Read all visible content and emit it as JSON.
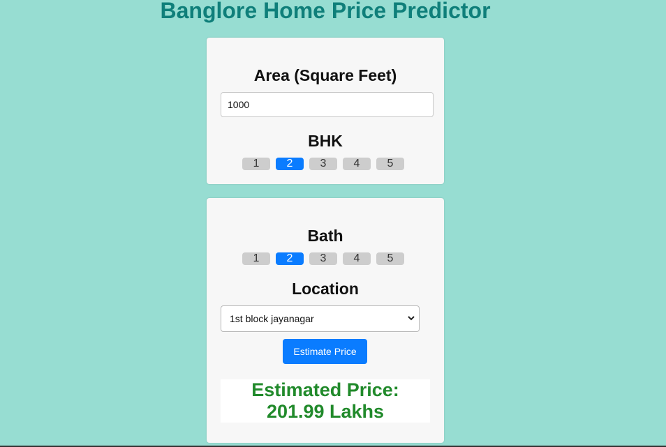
{
  "header": {
    "title": "Banglore Home Price Predictor"
  },
  "area": {
    "label": "Area (Square Feet)",
    "value": "1000"
  },
  "bhk": {
    "label": "BHK",
    "options": [
      "1",
      "2",
      "3",
      "4",
      "5"
    ],
    "selected": "2"
  },
  "bath": {
    "label": "Bath",
    "options": [
      "1",
      "2",
      "3",
      "4",
      "5"
    ],
    "selected": "2"
  },
  "location": {
    "label": "Location",
    "selected": "1st block jayanagar"
  },
  "actions": {
    "estimate_label": "Estimate Price"
  },
  "result": {
    "line1": "Estimated Price:",
    "line2": "201.99 Lakhs"
  },
  "colors": {
    "background": "#97ddd2",
    "title": "#0f7f7a",
    "accent": "#0a7cff",
    "result": "#218a2b"
  }
}
